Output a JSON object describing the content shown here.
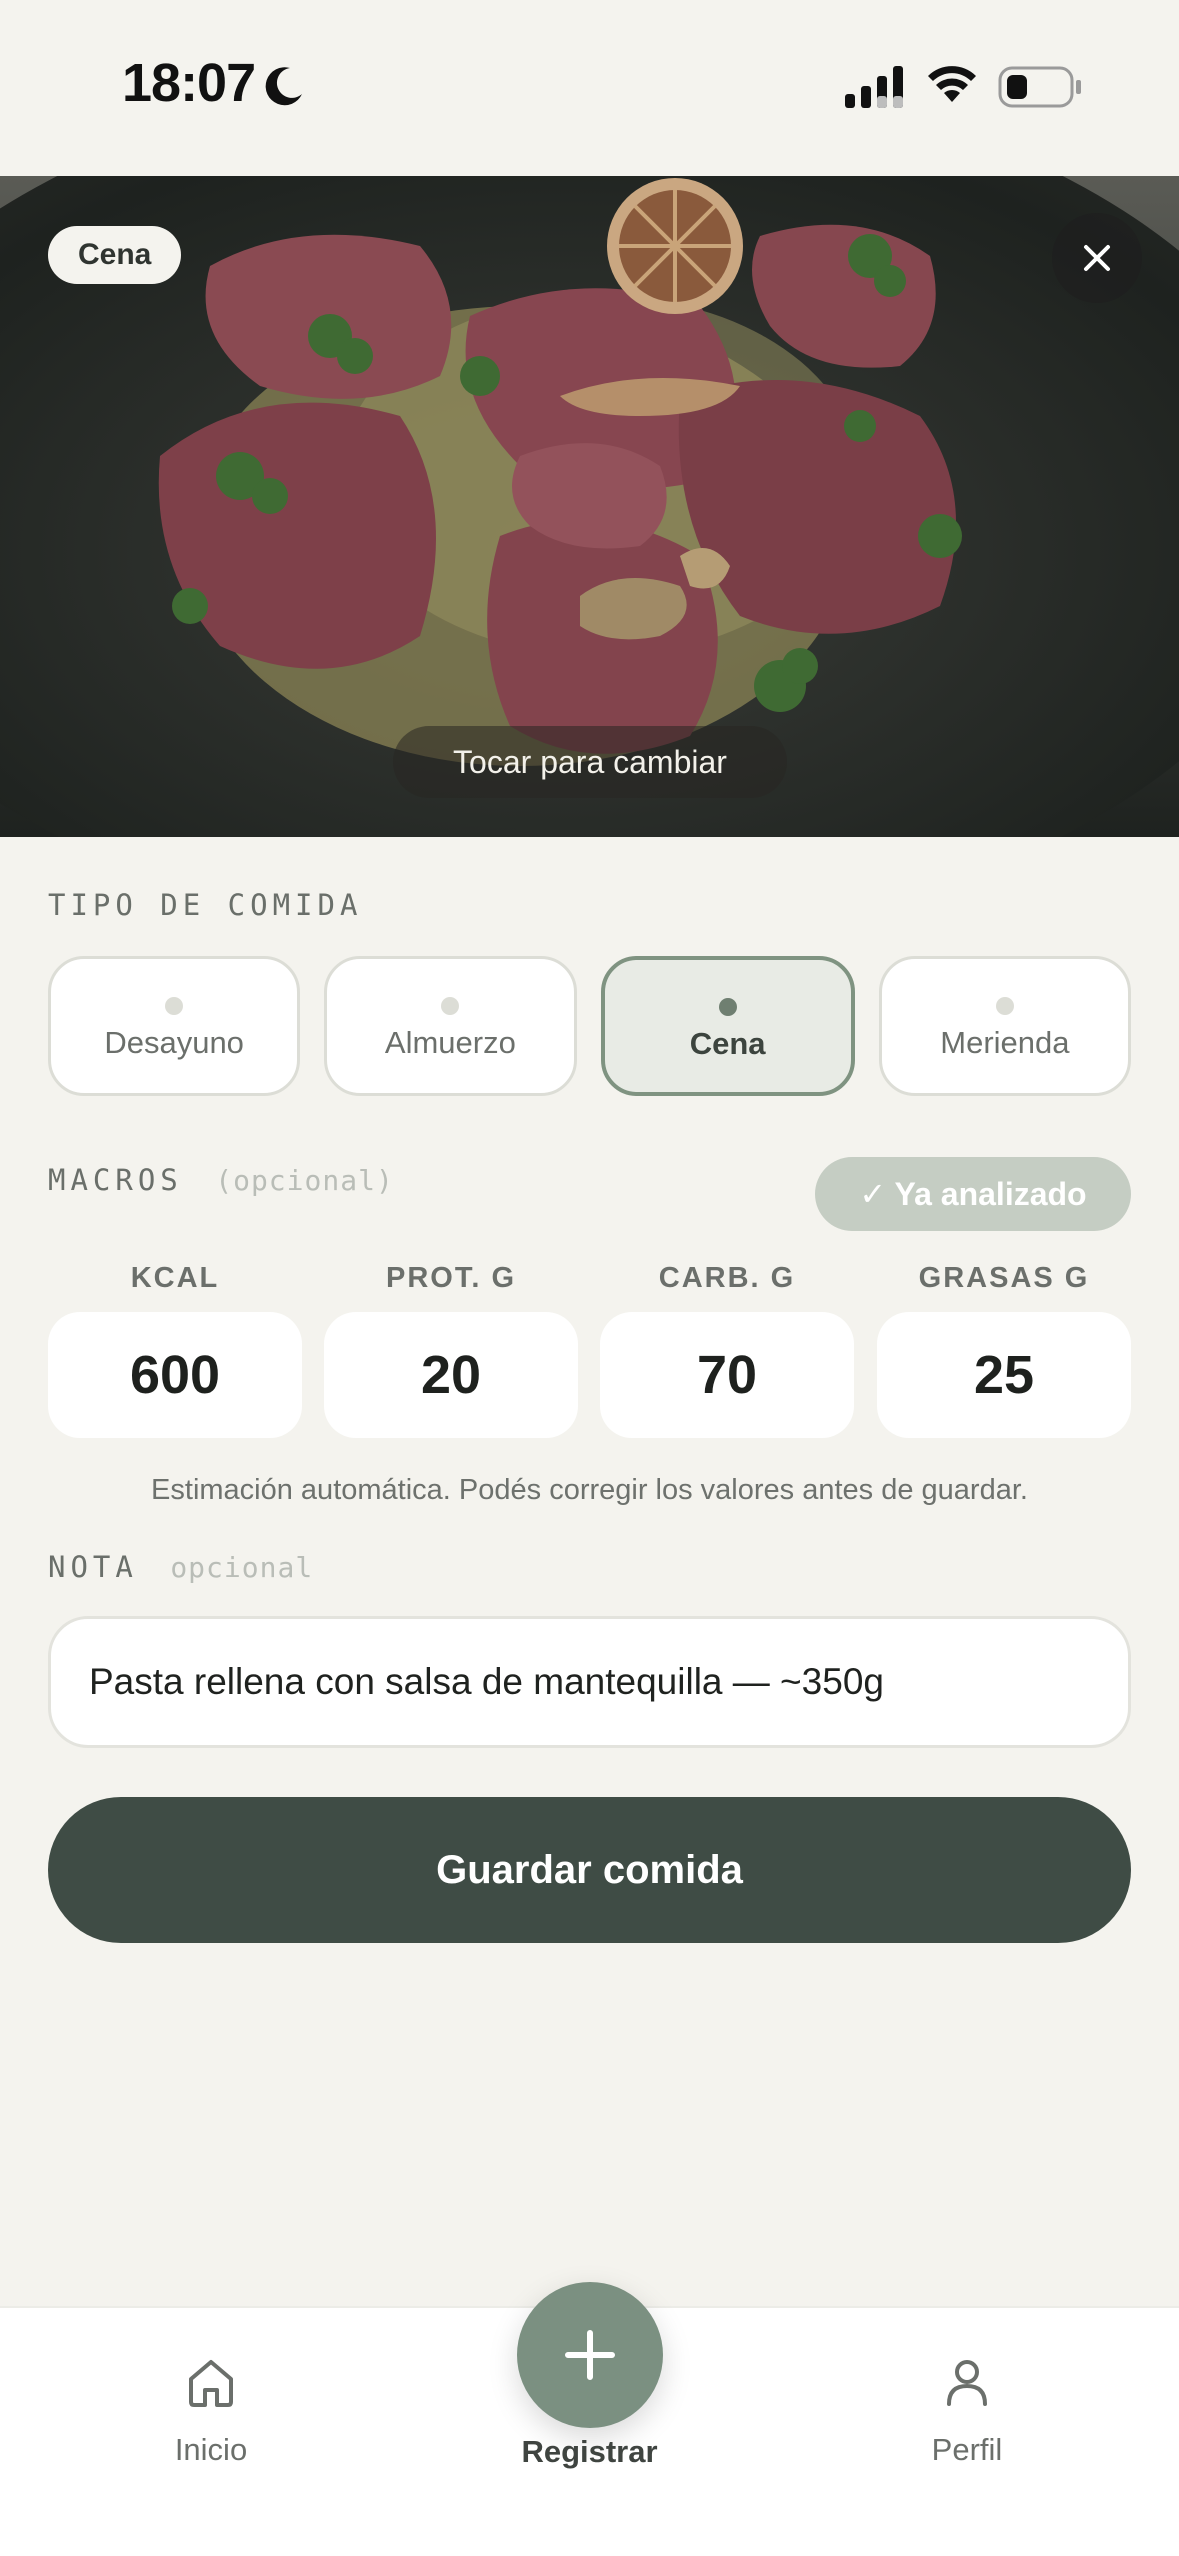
{
  "status_bar": {
    "time": "18:07"
  },
  "photo": {
    "meal_chip": "Cena",
    "change_hint": "Tocar para cambiar"
  },
  "meal_type": {
    "label": "TIPO DE COMIDA",
    "options": [
      "Desayuno",
      "Almuerzo",
      "Cena",
      "Merienda"
    ],
    "selected": "Cena"
  },
  "macros": {
    "label": "MACROS",
    "optional": "(opcional)",
    "analyzed_badge": "✓ Ya analizado",
    "fields": [
      {
        "label": "KCAL",
        "value": "600"
      },
      {
        "label": "PROT. G",
        "value": "20"
      },
      {
        "label": "CARB. G",
        "value": "70"
      },
      {
        "label": "GRASAS G",
        "value": "25"
      }
    ],
    "hint": "Estimación automática. Podés corregir los valores antes de guardar."
  },
  "note": {
    "label": "NOTA",
    "optional": "opcional",
    "value": "Pasta rellena con salsa de mantequilla — ~350g"
  },
  "save_button": "Guardar comida",
  "tab_bar": {
    "home": "Inicio",
    "register": "Registrar",
    "profile": "Perfil"
  },
  "colors": {
    "background": "#f4f3ee",
    "primary_dark": "#3f4c45",
    "accent": "#7b9081",
    "badge": "#c5cdc3"
  },
  "icons": [
    "moon-icon",
    "signal-icon",
    "wifi-icon",
    "battery-icon",
    "close-icon",
    "home-icon",
    "plus-icon",
    "person-icon"
  ]
}
